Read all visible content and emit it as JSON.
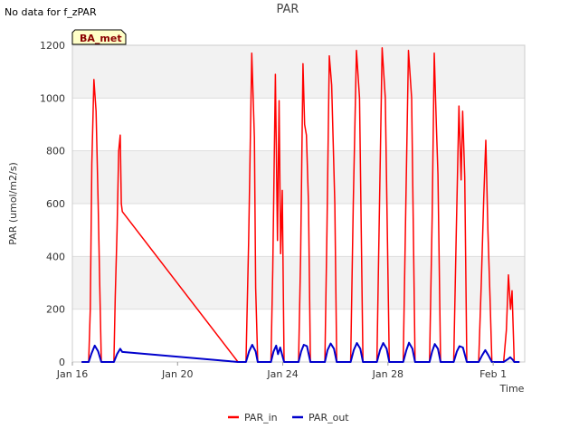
{
  "header": {
    "nodata_text": "No data for f_zPAR"
  },
  "chart_data": {
    "type": "line",
    "title": "PAR",
    "badge": "BA_met",
    "xlabel": "Time",
    "ylabel": "PAR (umol/m2/s)",
    "ylim": [
      0,
      1200
    ],
    "yticks": [
      0,
      200,
      400,
      600,
      800,
      1000,
      1200
    ],
    "xlim": [
      0,
      17.2
    ],
    "xticks": [
      {
        "value": 0,
        "label": "Jan 16"
      },
      {
        "value": 4,
        "label": "Jan 20"
      },
      {
        "value": 8,
        "label": "Jan 24"
      },
      {
        "value": 12,
        "label": "Jan 28"
      },
      {
        "value": 16,
        "label": "Feb 1"
      }
    ],
    "x_note": "x values are days since Jan 16 00:00",
    "grid": true,
    "legend_position": "bottom",
    "series": [
      {
        "name": "PAR_in",
        "color": "#ff0000",
        "points": [
          [
            0.35,
            0
          ],
          [
            0.5,
            0
          ],
          [
            0.62,
            0
          ],
          [
            0.68,
            200
          ],
          [
            0.74,
            750
          ],
          [
            0.82,
            1070
          ],
          [
            0.9,
            950
          ],
          [
            0.98,
            600
          ],
          [
            1.04,
            300
          ],
          [
            1.1,
            0
          ],
          [
            1.58,
            0
          ],
          [
            1.63,
            250
          ],
          [
            1.7,
            500
          ],
          [
            1.76,
            800
          ],
          [
            1.82,
            860
          ],
          [
            1.86,
            600
          ],
          [
            1.9,
            570
          ],
          [
            6.3,
            0
          ],
          [
            6.6,
            0
          ],
          [
            6.7,
            450
          ],
          [
            6.82,
            1170
          ],
          [
            6.92,
            850
          ],
          [
            6.97,
            280
          ],
          [
            7.05,
            0
          ],
          [
            7.55,
            0
          ],
          [
            7.62,
            350
          ],
          [
            7.72,
            1090
          ],
          [
            7.8,
            460
          ],
          [
            7.86,
            990
          ],
          [
            7.92,
            410
          ],
          [
            7.98,
            650
          ],
          [
            8.05,
            0
          ],
          [
            8.6,
            0
          ],
          [
            8.68,
            400
          ],
          [
            8.77,
            1130
          ],
          [
            8.83,
            900
          ],
          [
            8.9,
            860
          ],
          [
            8.98,
            600
          ],
          [
            9.05,
            0
          ],
          [
            9.6,
            0
          ],
          [
            9.68,
            500
          ],
          [
            9.77,
            1160
          ],
          [
            9.86,
            1050
          ],
          [
            9.98,
            600
          ],
          [
            10.05,
            0
          ],
          [
            10.58,
            0
          ],
          [
            10.68,
            600
          ],
          [
            10.8,
            1180
          ],
          [
            10.92,
            1000
          ],
          [
            11.05,
            0
          ],
          [
            11.58,
            0
          ],
          [
            11.68,
            600
          ],
          [
            11.78,
            1190
          ],
          [
            11.9,
            1000
          ],
          [
            12.05,
            0
          ],
          [
            12.58,
            0
          ],
          [
            12.68,
            600
          ],
          [
            12.78,
            1180
          ],
          [
            12.9,
            1000
          ],
          [
            13.03,
            0
          ],
          [
            13.58,
            0
          ],
          [
            13.68,
            550
          ],
          [
            13.76,
            1170
          ],
          [
            13.84,
            900
          ],
          [
            13.9,
            710
          ],
          [
            14.0,
            0
          ],
          [
            14.5,
            0
          ],
          [
            14.6,
            500
          ],
          [
            14.7,
            970
          ],
          [
            14.78,
            690
          ],
          [
            14.84,
            950
          ],
          [
            14.92,
            700
          ],
          [
            15.0,
            0
          ],
          [
            15.45,
            0
          ],
          [
            15.55,
            300
          ],
          [
            15.64,
            620
          ],
          [
            15.72,
            840
          ],
          [
            15.8,
            500
          ],
          [
            15.88,
            250
          ],
          [
            15.95,
            0
          ],
          [
            16.4,
            0
          ],
          [
            16.5,
            120
          ],
          [
            16.58,
            330
          ],
          [
            16.66,
            200
          ],
          [
            16.72,
            270
          ],
          [
            16.8,
            0
          ],
          [
            17.0,
            0
          ]
        ]
      },
      {
        "name": "PAR_out",
        "color": "#0000cc",
        "points": [
          [
            0.35,
            0
          ],
          [
            0.62,
            0
          ],
          [
            0.72,
            30
          ],
          [
            0.85,
            62
          ],
          [
            0.98,
            40
          ],
          [
            1.1,
            0
          ],
          [
            1.58,
            0
          ],
          [
            1.7,
            30
          ],
          [
            1.82,
            50
          ],
          [
            1.9,
            38
          ],
          [
            6.3,
            0
          ],
          [
            6.6,
            0
          ],
          [
            6.72,
            40
          ],
          [
            6.84,
            65
          ],
          [
            6.97,
            40
          ],
          [
            7.05,
            0
          ],
          [
            7.55,
            0
          ],
          [
            7.65,
            40
          ],
          [
            7.75,
            62
          ],
          [
            7.82,
            30
          ],
          [
            7.9,
            55
          ],
          [
            8.05,
            0
          ],
          [
            8.6,
            0
          ],
          [
            8.7,
            40
          ],
          [
            8.8,
            65
          ],
          [
            8.92,
            60
          ],
          [
            9.05,
            0
          ],
          [
            9.6,
            0
          ],
          [
            9.7,
            45
          ],
          [
            9.82,
            70
          ],
          [
            9.95,
            50
          ],
          [
            10.05,
            0
          ],
          [
            10.58,
            0
          ],
          [
            10.7,
            45
          ],
          [
            10.82,
            72
          ],
          [
            10.95,
            50
          ],
          [
            11.05,
            0
          ],
          [
            11.58,
            0
          ],
          [
            11.7,
            45
          ],
          [
            11.82,
            72
          ],
          [
            11.95,
            50
          ],
          [
            12.05,
            0
          ],
          [
            12.58,
            0
          ],
          [
            12.7,
            45
          ],
          [
            12.8,
            73
          ],
          [
            12.93,
            50
          ],
          [
            13.03,
            0
          ],
          [
            13.58,
            0
          ],
          [
            13.68,
            40
          ],
          [
            13.78,
            68
          ],
          [
            13.9,
            50
          ],
          [
            14.0,
            0
          ],
          [
            14.5,
            0
          ],
          [
            14.62,
            40
          ],
          [
            14.72,
            60
          ],
          [
            14.85,
            55
          ],
          [
            15.0,
            0
          ],
          [
            15.45,
            0
          ],
          [
            15.58,
            25
          ],
          [
            15.7,
            45
          ],
          [
            15.82,
            25
          ],
          [
            15.95,
            0
          ],
          [
            16.4,
            0
          ],
          [
            16.55,
            10
          ],
          [
            16.65,
            18
          ],
          [
            16.75,
            8
          ],
          [
            16.8,
            0
          ],
          [
            17.0,
            0
          ]
        ]
      }
    ]
  }
}
